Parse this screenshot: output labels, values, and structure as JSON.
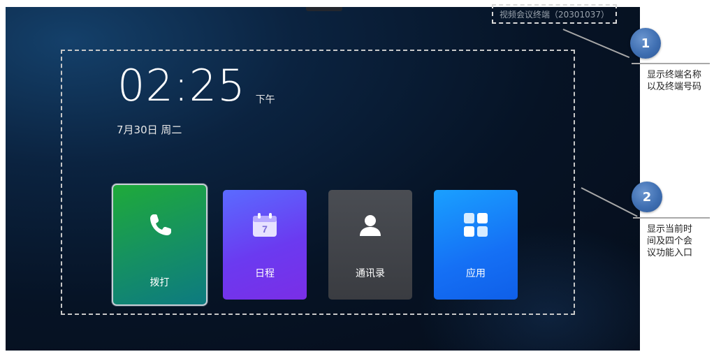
{
  "terminal": {
    "label": "视频会议终端（20301037）"
  },
  "clock": {
    "time": "02:25",
    "ampm": "下午",
    "date": "7月30日 周二"
  },
  "tiles": [
    {
      "label": "拨打",
      "icon": "phone-icon",
      "color": "#1faa3a"
    },
    {
      "label": "日程",
      "icon": "calendar-icon",
      "calendar_day": "7",
      "color": "#6b3af0"
    },
    {
      "label": "通讯录",
      "icon": "contact-person-icon",
      "color": "#4a4d53"
    },
    {
      "label": "应用",
      "icon": "apps-grid-icon",
      "color": "#1570f5"
    }
  ],
  "callouts": [
    {
      "number": "1",
      "text_line1": "显示终端名称",
      "text_line2": "以及终端号码"
    },
    {
      "number": "2",
      "text_line1": "显示当前时",
      "text_line2": "间及四个会",
      "text_line3": "议功能入口"
    }
  ],
  "colors": {
    "badge": "#3f6fb2",
    "dash_border": "#c8c8c8"
  }
}
